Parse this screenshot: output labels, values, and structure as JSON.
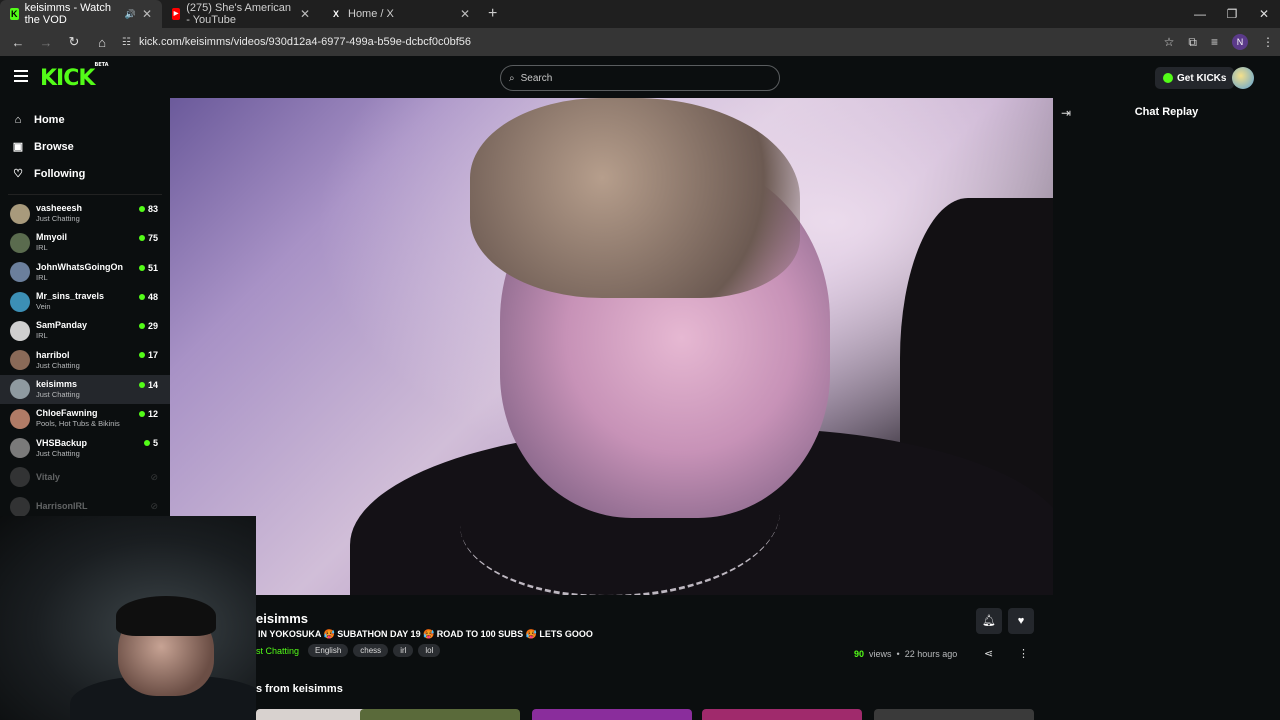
{
  "browser": {
    "tabs": [
      {
        "title": "keisimms - Watch the VOD",
        "favicon": "K",
        "favicon_color": "#53fc18",
        "active": true
      },
      {
        "title": "(275) She's American - YouTube",
        "favicon": "▶",
        "favicon_color": "#ff0000",
        "active": false
      },
      {
        "title": "Home / X",
        "favicon": "X",
        "favicon_color": "#1f1f1f",
        "active": false
      }
    ],
    "new_tab": "+",
    "url": "kick.com/keisimms/videos/930d12a4-6977-499a-b59e-dcbcf0c0bf56",
    "profile_initial": "N"
  },
  "header": {
    "logo": "KICK",
    "logo_badge": "BETA",
    "search_placeholder": "Search",
    "get_kicks": "Get KICKs"
  },
  "sidebar": {
    "nav": [
      {
        "label": "Home",
        "icon": "home-icon"
      },
      {
        "label": "Browse",
        "icon": "browse-icon"
      },
      {
        "label": "Following",
        "icon": "heart-icon"
      }
    ],
    "channels": [
      {
        "name": "vasheeesh",
        "category": "Just Chatting",
        "viewers": "83",
        "avatar_color": "#a89a7c"
      },
      {
        "name": "Mmyoil",
        "category": "IRL",
        "viewers": "75",
        "avatar_color": "#5a6b4e"
      },
      {
        "name": "JohnWhatsGoingOn",
        "category": "IRL",
        "viewers": "51",
        "avatar_color": "#6b7f9c"
      },
      {
        "name": "Mr_sins_travels",
        "category": "Vein",
        "viewers": "48",
        "avatar_color": "#3c8fb5"
      },
      {
        "name": "SamPanday",
        "category": "IRL",
        "viewers": "29",
        "avatar_color": "#cfcfcf"
      },
      {
        "name": "harribol",
        "category": "Just Chatting",
        "viewers": "17",
        "avatar_color": "#8a6a58"
      },
      {
        "name": "keisimms",
        "category": "Just Chatting",
        "viewers": "14",
        "avatar_color": "#8f9aa0"
      },
      {
        "name": "ChloeFawning",
        "category": "Pools, Hot Tubs & Bikinis",
        "viewers": "12",
        "avatar_color": "#b07b66"
      },
      {
        "name": "VHSBackup",
        "category": "Just Chatting",
        "viewers": "5",
        "avatar_color": "#7a7a7a"
      },
      {
        "name": "Vitaly",
        "category": "",
        "viewers": "",
        "avatar_color": "#7a7a7a"
      },
      {
        "name": "HarrisonIRL",
        "category": "",
        "viewers": "",
        "avatar_color": "#7a7a7a"
      }
    ]
  },
  "chat": {
    "title": "Chat Replay"
  },
  "video_info": {
    "streamer": "eisimms",
    "title": "IN YOKOSUKA 🥵 SUBATHON DAY 19 🥵 ROAD TO 100 SUBS 🥵 LETS GOOO",
    "category": "st Chatting",
    "tags": [
      "English",
      "chess",
      "irl",
      "lol"
    ],
    "views_count": "90",
    "views_label": "views",
    "separator": "•",
    "time_ago": "22 hours ago",
    "more_heading": "s from keisimms"
  }
}
